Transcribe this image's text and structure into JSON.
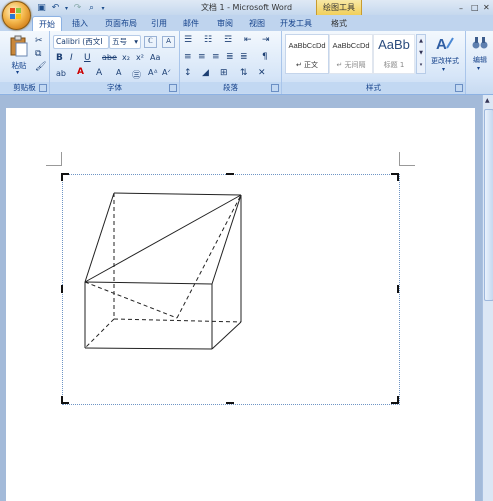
{
  "title": "文档 1 - Microsoft Word",
  "contextual_tab": "绘图工具",
  "tabs": [
    "开始",
    "插入",
    "页面布局",
    "引用",
    "邮件",
    "审阅",
    "视图",
    "开发工具",
    "格式"
  ],
  "clipboard": {
    "paste_label": "粘贴",
    "group_label": "剪贴板"
  },
  "font": {
    "name": "Calibri (西文I",
    "size": "五号",
    "group_label": "字体"
  },
  "paragraph": {
    "group_label": "段落"
  },
  "styles": {
    "group_label": "样式",
    "items": [
      {
        "sample": "AaBbCcDd",
        "name": "↵ 正文"
      },
      {
        "sample": "AaBbCcDd",
        "name": "↵ 无间隔"
      },
      {
        "sample": "AaBb",
        "name": "标题 1"
      }
    ],
    "change_label": "更改样式"
  },
  "editing": {
    "label": "编辑"
  },
  "colors": {
    "accent": "#15428b",
    "ribbon_bg": "#d7e6f8",
    "doc_bg": "#a3bad9",
    "drawing_tab": "#f1cf5b"
  }
}
